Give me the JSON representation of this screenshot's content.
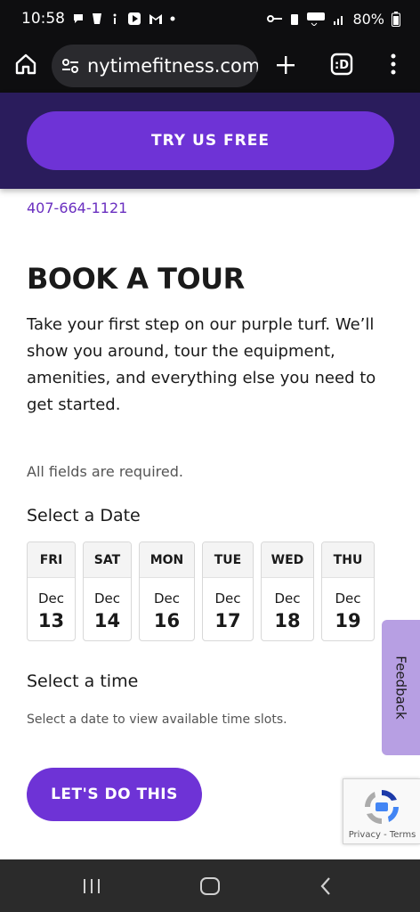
{
  "status_bar": {
    "time": "10:58",
    "battery": "80%"
  },
  "browser": {
    "url": "nytimefitness.com"
  },
  "promo": {
    "cta_label": "TRY US FREE"
  },
  "contact": {
    "phone": "407-664-1121"
  },
  "form": {
    "title": "BOOK A TOUR",
    "description": "Take your first step on our purple turf. We’ll show you around, tour the equipment, amenities, and everything else you need to get started.",
    "required_note": "All fields are required.",
    "date_label": "Select a Date",
    "dates": [
      {
        "day": "FRI",
        "month": "Dec",
        "date": "13"
      },
      {
        "day": "SAT",
        "month": "Dec",
        "date": "14"
      },
      {
        "day": "MON",
        "month": "Dec",
        "date": "16"
      },
      {
        "day": "TUE",
        "month": "Dec",
        "date": "17"
      },
      {
        "day": "WED",
        "month": "Dec",
        "date": "18"
      },
      {
        "day": "THU",
        "month": "Dec",
        "date": "19"
      }
    ],
    "time_label": "Select a time",
    "time_hint": "Select a date to view available time slots.",
    "submit_label": "LET'S DO THIS"
  },
  "feedback_tab": {
    "label": "Feedback"
  },
  "recaptcha": {
    "terms": "Privacy - Terms"
  },
  "colors": {
    "brand_purple": "#6e33d6",
    "header_dark_purple": "#2a1c5c",
    "feedback_purple": "#b79fe3",
    "link_purple": "#6a2fc0"
  }
}
